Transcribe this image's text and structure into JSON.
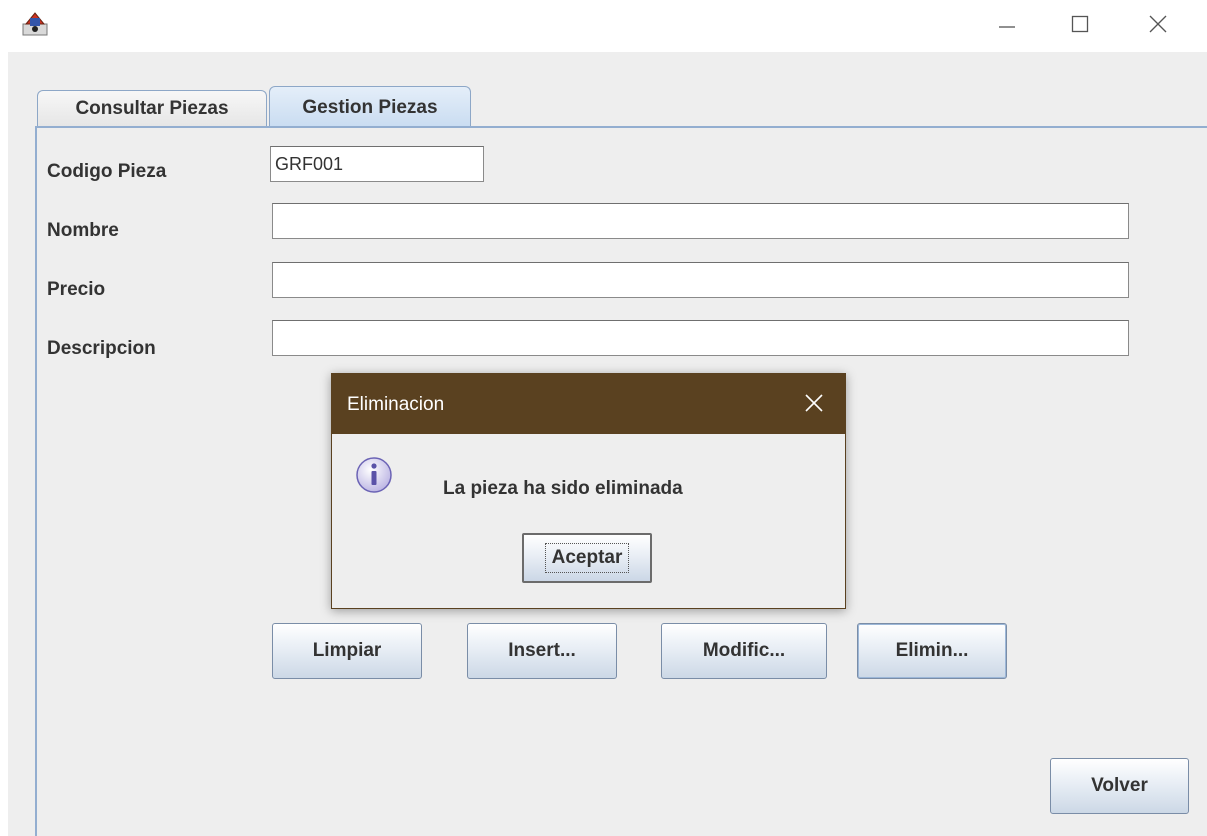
{
  "titlebar": {
    "icons": {
      "app": "java-app-icon",
      "minimize": "minimize-icon",
      "maximize": "maximize-icon",
      "close": "close-icon"
    }
  },
  "tabs": [
    {
      "label": "Consultar Piezas",
      "selected": false
    },
    {
      "label": "Gestion Piezas",
      "selected": true
    }
  ],
  "form": {
    "codigo_label": "Codigo Pieza",
    "codigo_value": "GRF001",
    "nombre_label": "Nombre",
    "nombre_value": "",
    "precio_label": "Precio",
    "precio_value": "",
    "descripcion_label": "Descripcion",
    "descripcion_value": ""
  },
  "actions": {
    "limpiar": "Limpiar",
    "insertar": "Insert...",
    "modificar": "Modific...",
    "eliminar": "Elimin...",
    "volver": "Volver"
  },
  "dialog": {
    "title": "Eliminacion",
    "message": "La pieza ha sido eliminada",
    "ok_label": "Aceptar",
    "icon": "info-icon"
  },
  "colors": {
    "dialog_titlebar": "#5a4120",
    "tab_selected": "#c9dcf1",
    "panel_border": "#93aed0",
    "background": "#eeeeee"
  }
}
